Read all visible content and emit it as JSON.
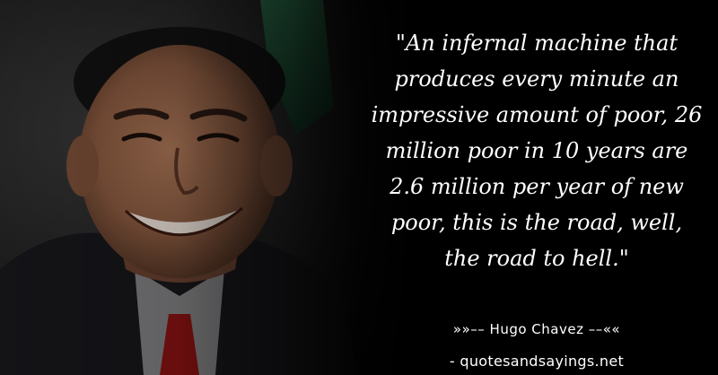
{
  "quote": {
    "lines": [
      "\"An infernal machine that",
      "produces every minute an",
      "impressive amount of poor, 26",
      "million poor in 10 years are",
      "2.6 million per year of new",
      "poor, this is the road, well,",
      "the road to hell.\""
    ]
  },
  "author": {
    "text": "»»–– Hugo Chavez ––««"
  },
  "site": {
    "text": "- quotesandsayings.net"
  },
  "colors": {
    "background": "#000000",
    "text": "#ffffff",
    "flag_green": "#1f5a3a",
    "suit": "#1a1a1e",
    "tie_red": "#8a1212",
    "skin": "#8a5a40"
  }
}
